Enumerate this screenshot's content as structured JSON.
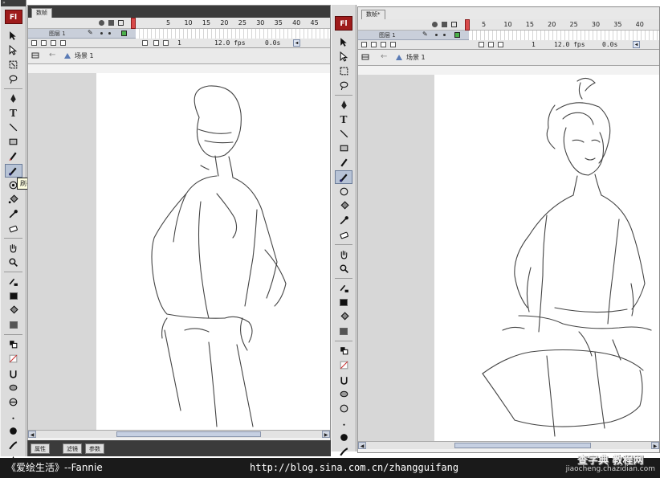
{
  "app": {
    "logo": "Fl",
    "grip": "»"
  },
  "left_window": {
    "doc_tab": "数帧",
    "ruler": [
      "5",
      "10",
      "15",
      "20",
      "25",
      "30",
      "35",
      "40",
      "45"
    ],
    "layer_name": "图层 1",
    "status": {
      "frame": "1",
      "fps": "12.0 fps",
      "time": "0.0s"
    },
    "scene": "场景 1",
    "tooltip": "刷子工具 (B)"
  },
  "right_window": {
    "doc_tab": "数帧*",
    "ruler": [
      "5",
      "10",
      "15",
      "20",
      "25",
      "30",
      "35",
      "40"
    ],
    "layer_name": "图层 1",
    "status": {
      "frame": "1",
      "fps": "12.0 fps",
      "time": "0.0s"
    },
    "scene": "场景 1"
  },
  "properties_tabs": [
    "属性",
    "滤镜",
    "参数"
  ],
  "footer": {
    "signature": "《爱绘生活》--Fannie",
    "url": "http://blog.sina.com.cn/zhangguifang"
  },
  "watermark": {
    "brand": "查字典 教程网",
    "domain": "jiaocheng.chazidian.com"
  },
  "colors": {
    "accent": "#9e1b1b",
    "playhead": "#d84a4a",
    "layer_frame": "#4ab04a",
    "toolbar_bg": "#dcdcdc",
    "tab_bar": "#3b3b3b"
  },
  "icons": [
    "arrow-icon",
    "subselect-icon",
    "free-transform-icon",
    "lasso-icon",
    "pen-icon",
    "text-icon",
    "line-icon",
    "rectangle-icon",
    "pencil-icon",
    "brush-icon",
    "deco-icon",
    "paint-bucket-icon",
    "eyedropper-icon",
    "eraser-icon",
    "hand-icon",
    "zoom-icon",
    "stroke-color-icon",
    "fill-color-icon",
    "snap-icon",
    "smooth-icon"
  ]
}
